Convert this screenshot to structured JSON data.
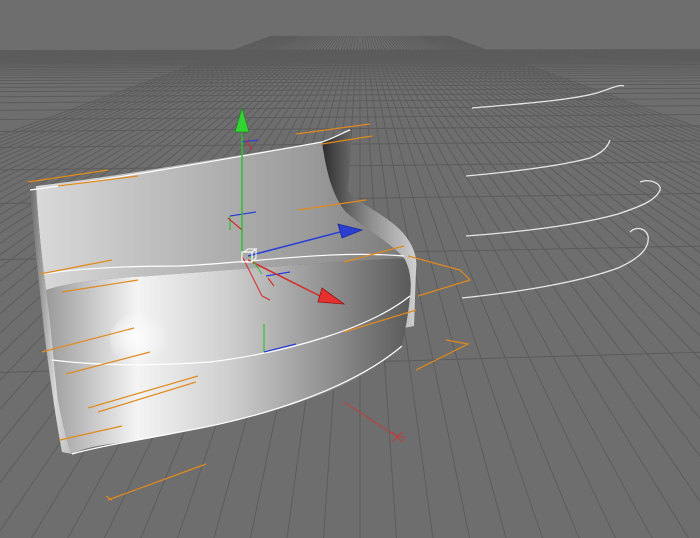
{
  "viewport": {
    "name": "3d-perspective-viewport",
    "background_color": "#6e6e6e",
    "grid_color": "#5c5c5c",
    "grid_major_color": "#555555"
  },
  "colors": {
    "spline": "#e8e8e8",
    "guide": "#e08a1e",
    "axis_x": "#d42a2a",
    "axis_y": "#2fc02f",
    "axis_z": "#2a3ed4",
    "surface_light": "#f2f2f2",
    "surface_mid": "#a8a8a8",
    "surface_dark": "#3a3a3a",
    "edge": "#ffffff"
  },
  "objects": {
    "loft_surface": "loft-nurbs-surface",
    "profile_splines": [
      "profile-spline-1",
      "profile-spline-2",
      "profile-spline-3",
      "profile-spline-4"
    ],
    "move_gizmo": "move-manipulator",
    "world_axis": "world-axis-marker"
  }
}
